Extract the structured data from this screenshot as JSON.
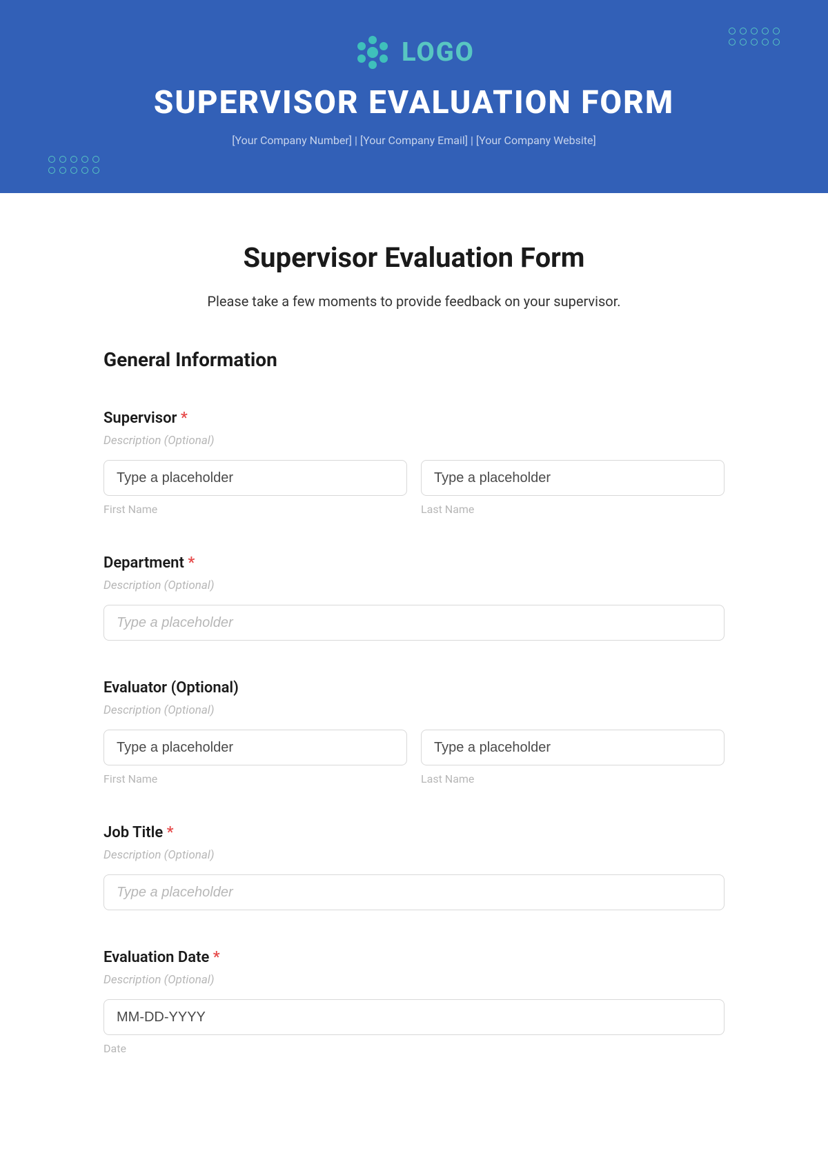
{
  "banner": {
    "logo_text": "LOGO",
    "title": "SUPERVISOR EVALUATION FORM",
    "sub": "[Your Company Number]  |  [Your Company Email]  |  [Your Company Website]"
  },
  "form": {
    "title": "Supervisor Evaluation Form",
    "subtitle": "Please take a few moments to provide feedback on your supervisor.",
    "section_heading": "General Information",
    "desc_placeholder": "Description (Optional)",
    "required_mark": "*",
    "first_name_label": "First Name",
    "last_name_label": "Last Name",
    "date_label": "Date",
    "fields": {
      "supervisor": {
        "label": "Supervisor",
        "first_placeholder": "Type a placeholder",
        "last_placeholder": "Type a placeholder"
      },
      "department": {
        "label": "Department",
        "placeholder": "Type a placeholder"
      },
      "evaluator": {
        "label": "Evaluator (Optional)",
        "first_placeholder": "Type a placeholder",
        "last_placeholder": "Type a placeholder"
      },
      "job_title": {
        "label": "Job Title",
        "placeholder": "Type a placeholder"
      },
      "evaluation_date": {
        "label": "Evaluation Date",
        "placeholder": "MM-DD-YYYY"
      }
    }
  }
}
